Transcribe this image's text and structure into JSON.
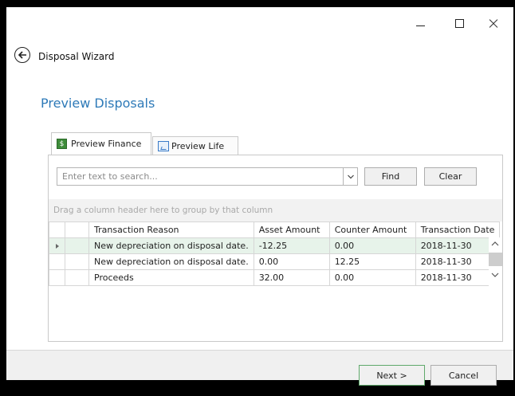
{
  "window": {
    "title": "Disposal Wizard",
    "min_icon": "minimize-icon",
    "max_icon": "maximize-icon",
    "close_icon": "close-icon"
  },
  "page": {
    "title": "Preview Disposals"
  },
  "tabs": [
    {
      "label": "Preview Finance",
      "icon": "finance-icon",
      "active": true
    },
    {
      "label": "Preview Life",
      "icon": "chart-icon",
      "active": false
    }
  ],
  "search": {
    "placeholder": "Enter text to search...",
    "find_label": "Find",
    "clear_label": "Clear"
  },
  "grid": {
    "group_hint": "Drag a column header here to group by that column",
    "columns": [
      "Transaction Reason",
      "Asset Amount",
      "Counter Amount",
      "Transaction Date"
    ],
    "rows": [
      [
        "New depreciation on disposal date.",
        "-12.25",
        "0.00",
        "2018-11-30"
      ],
      [
        "New depreciation on disposal date.",
        "0.00",
        "12.25",
        "2018-11-30"
      ],
      [
        "Proceeds",
        "32.00",
        "0.00",
        "2018-11-30"
      ]
    ],
    "selected_row": 0,
    "selected_color": "#e7f3ea"
  },
  "footer": {
    "next_label": "Next >",
    "cancel_label": "Cancel"
  },
  "colors": {
    "title_blue": "#2e7ab8",
    "next_border": "#5fa96b"
  }
}
